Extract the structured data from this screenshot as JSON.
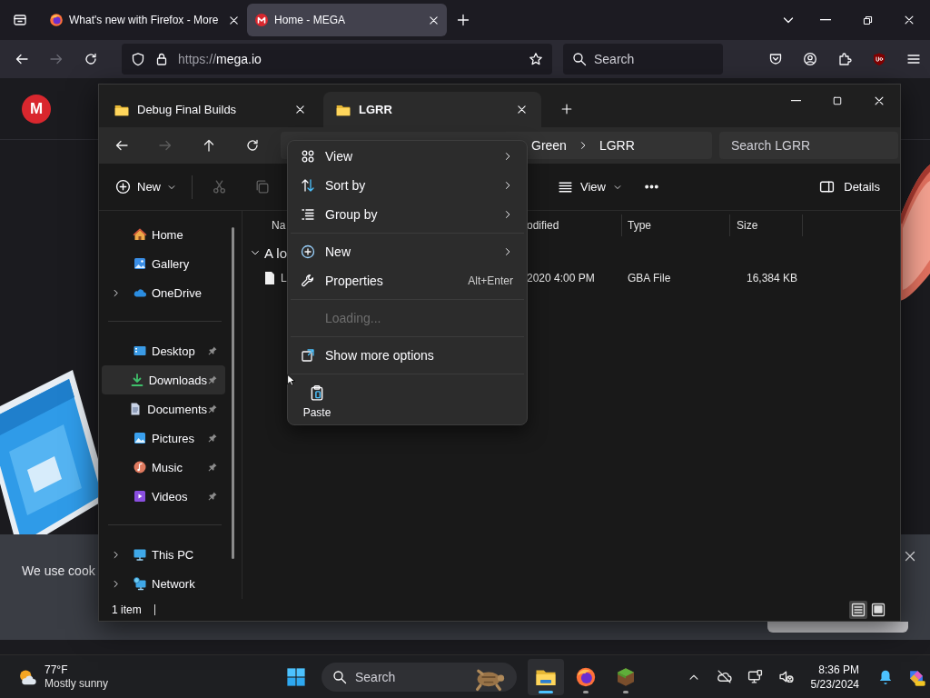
{
  "browser": {
    "tabs": [
      {
        "title": "What's new with Firefox - More",
        "selected": false
      },
      {
        "title": "Home - MEGA",
        "selected": true
      }
    ],
    "address": {
      "scheme": "https://",
      "host": "mega.io"
    },
    "search": {
      "placeholder": "Search"
    }
  },
  "page": {
    "logo": "M",
    "cookie_banner": {
      "text": "We use cook"
    }
  },
  "explorer": {
    "tabs": [
      {
        "title": "Debug Final Builds",
        "selected": false
      },
      {
        "title": "LGRR",
        "selected": true
      }
    ],
    "breadcrumb": [
      "Green",
      "LGRR"
    ],
    "search": {
      "placeholder": "Search LGRR"
    },
    "toolbar": {
      "new": "New",
      "view": "View",
      "details": "Details"
    },
    "sidebar": [
      {
        "items": [
          {
            "label": "Home",
            "expandable": false,
            "pinned": false,
            "selected": false
          },
          {
            "label": "Gallery",
            "expandable": false,
            "pinned": false,
            "selected": false
          },
          {
            "label": "OneDrive",
            "expandable": true,
            "pinned": false,
            "selected": false
          }
        ]
      },
      {
        "items": [
          {
            "label": "Desktop",
            "expandable": false,
            "pinned": true,
            "selected": false
          },
          {
            "label": "Downloads",
            "expandable": false,
            "pinned": true,
            "selected": true
          },
          {
            "label": "Documents",
            "expandable": false,
            "pinned": true,
            "selected": false
          },
          {
            "label": "Pictures",
            "expandable": false,
            "pinned": true,
            "selected": false
          },
          {
            "label": "Music",
            "expandable": false,
            "pinned": true,
            "selected": false
          },
          {
            "label": "Videos",
            "expandable": false,
            "pinned": true,
            "selected": false
          }
        ]
      },
      {
        "items": [
          {
            "label": "This PC",
            "expandable": true,
            "pinned": false,
            "selected": false
          },
          {
            "label": "Network",
            "expandable": true,
            "pinned": false,
            "selected": false
          }
        ]
      }
    ],
    "columns": [
      "Na",
      "odified",
      "Type",
      "Size"
    ],
    "group": {
      "label": "A lo",
      "expanded": true
    },
    "files": [
      {
        "name": "L",
        "modified": "2020 4:00 PM",
        "type": "GBA File",
        "size": "16,384 KB"
      }
    ],
    "status": "1 item",
    "views": [
      {
        "selected": true
      },
      {
        "selected": false
      }
    ]
  },
  "context_menu": {
    "items": [
      {
        "kind": "command",
        "label": "View",
        "submenu": true,
        "disabled": false
      },
      {
        "kind": "command",
        "label": "Sort by",
        "submenu": true,
        "disabled": false
      },
      {
        "kind": "command",
        "label": "Group by",
        "submenu": true,
        "disabled": false
      },
      {
        "kind": "separator"
      },
      {
        "kind": "command",
        "label": "New",
        "submenu": true,
        "disabled": false
      },
      {
        "kind": "command",
        "label": "Properties",
        "shortcut": "Alt+Enter",
        "submenu": false,
        "disabled": false
      },
      {
        "kind": "separator"
      },
      {
        "kind": "command",
        "label": "Loading...",
        "submenu": false,
        "disabled": true
      },
      {
        "kind": "separator"
      },
      {
        "kind": "command",
        "label": "Show more options",
        "submenu": false,
        "disabled": false
      },
      {
        "kind": "separator"
      }
    ],
    "actions": [
      {
        "label": "Paste"
      }
    ]
  },
  "taskbar": {
    "weather": {
      "temperature": "77°F",
      "condition": "Mostly sunny"
    },
    "search": {
      "placeholder": "Search"
    },
    "apps": [
      {
        "selected": true
      },
      {
        "selected": false
      },
      {
        "selected": false
      }
    ],
    "clock": {
      "time": "8:36 PM",
      "date": "5/23/2024"
    }
  }
}
